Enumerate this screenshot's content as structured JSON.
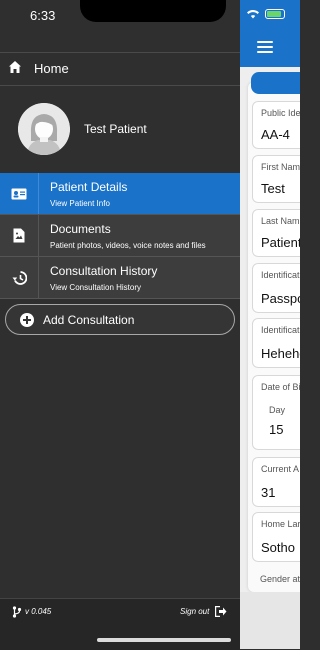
{
  "status_bar": {
    "time": "6:33"
  },
  "drawer": {
    "home_label": "Home",
    "patient_name": "Test Patient",
    "menu": [
      {
        "title": "Patient Details",
        "subtitle": "View Patient Info",
        "icon": "id-card-icon",
        "active": true
      },
      {
        "title": "Documents",
        "subtitle": "Patient photos, videos, voice notes and files",
        "icon": "document-icon",
        "active": false
      },
      {
        "title": "Consultation History",
        "subtitle": "View Consultation History",
        "icon": "history-icon",
        "active": false
      }
    ],
    "add_consultation_label": "Add Consultation",
    "footer": {
      "version": "v 0.045",
      "sign_out": "Sign out"
    }
  },
  "background_app": {
    "fields": [
      {
        "label": "Public Ide",
        "value": "AA-4"
      },
      {
        "label": "First Nam",
        "value": "Test"
      },
      {
        "label": "Last Nam",
        "value": "Patient"
      },
      {
        "label": "Identificat",
        "value": "Passpo"
      },
      {
        "label": "Identificat",
        "value": "Hehehe"
      },
      {
        "label": "Date of Bi",
        "sub_label": "Day",
        "value": "15"
      },
      {
        "label": "Current A",
        "value": "31"
      },
      {
        "label": "Home Lar",
        "value": "Sotho"
      },
      {
        "label": "Gender at",
        "value": ""
      }
    ]
  },
  "colors": {
    "accent": "#1a72c9",
    "drawer_bg": "#2f2f2f",
    "menu_bg": "#3d3d3d"
  }
}
